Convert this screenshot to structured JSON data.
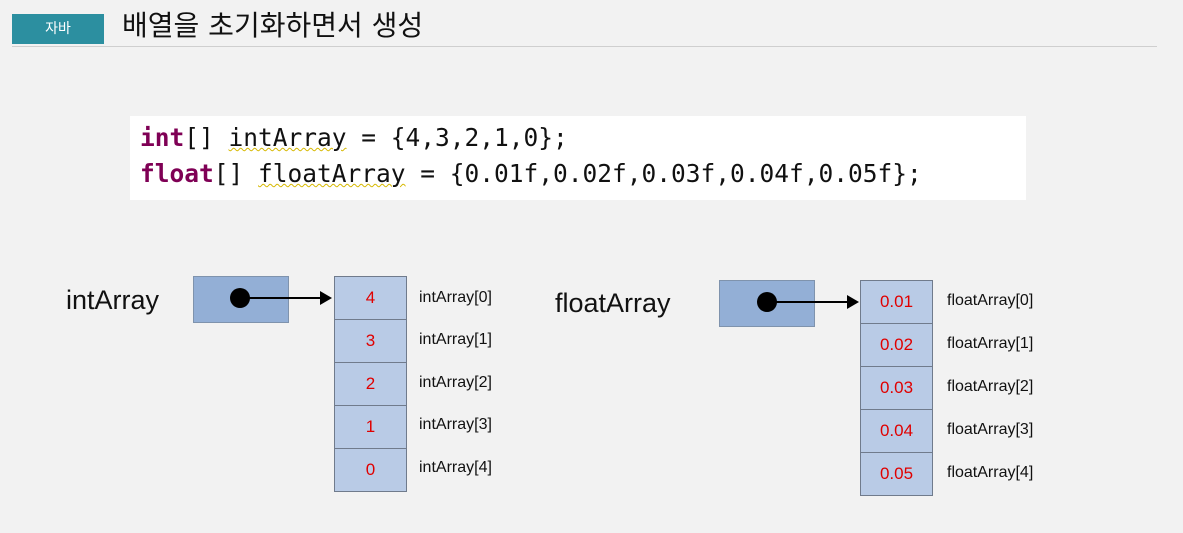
{
  "header": {
    "tag": "자바",
    "title": "배열을 초기화하면서 생성"
  },
  "code": {
    "line1": {
      "type": "int",
      "rest_a": "[] ",
      "var": "intArray",
      "rest_b": " = {4,3,2,1,0};"
    },
    "line2": {
      "type": "float",
      "rest_a": "[] ",
      "var": "floatArray",
      "rest_b": " = {0.01f,0.02f,0.03f,0.04f,0.05f};"
    }
  },
  "int_array": {
    "name": "intArray",
    "values": [
      "4",
      "3",
      "2",
      "1",
      "0"
    ],
    "indices": [
      "intArray[0]",
      "intArray[1]",
      "intArray[2]",
      "intArray[3]",
      "intArray[4]"
    ]
  },
  "float_array": {
    "name": "floatArray",
    "values": [
      "0.01",
      "0.02",
      "0.03",
      "0.04",
      "0.05"
    ],
    "indices": [
      "floatArray[0]",
      "floatArray[1]",
      "floatArray[2]",
      "floatArray[3]",
      "floatArray[4]"
    ]
  },
  "colors": {
    "tag": "#2c8fa0",
    "ref_box": "#93afd6",
    "cell": "#b9cbe6",
    "value_text": "#e00000",
    "keyword": "#7f0055"
  }
}
